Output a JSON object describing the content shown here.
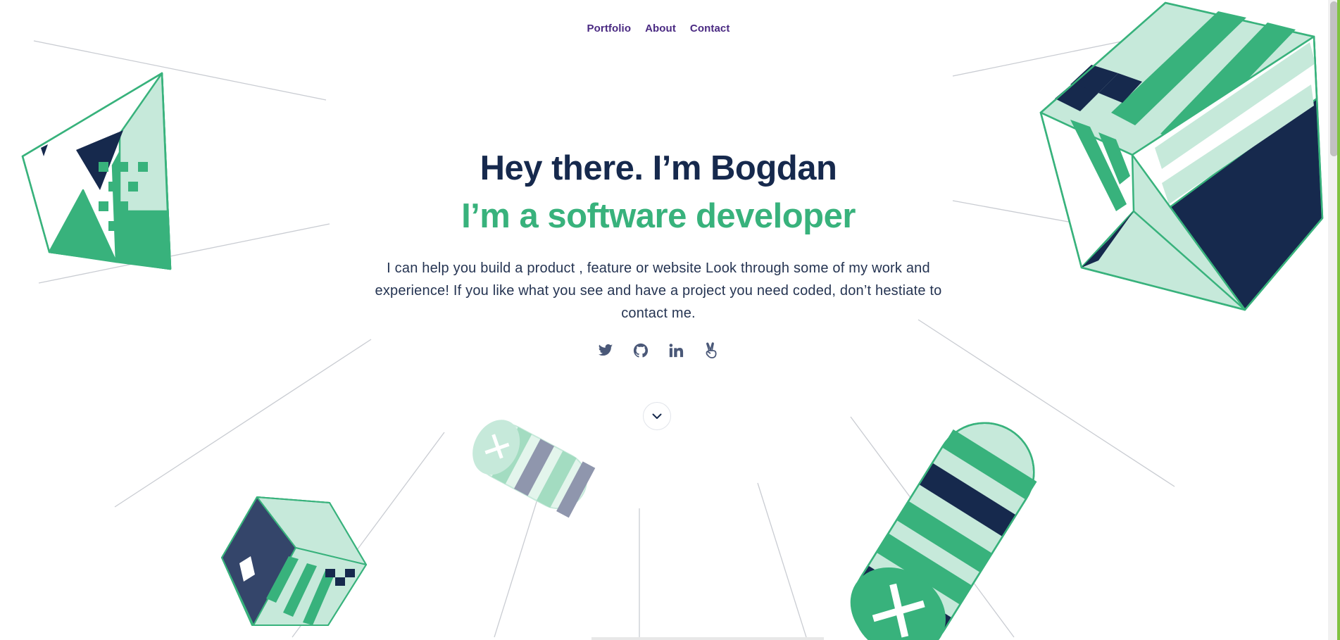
{
  "nav": {
    "items": [
      {
        "label": "Portfolio"
      },
      {
        "label": "About"
      },
      {
        "label": "Contact"
      }
    ]
  },
  "hero": {
    "title": "Hey there. I’m Bogdan",
    "subtitle": "I’m a software developer",
    "description": "I can help you build a product , feature or website Look through some of my work and experience! If you like what you see and have a project you need coded, don’t hestiate to contact me."
  },
  "socials": [
    {
      "icon": "twitter-icon"
    },
    {
      "icon": "github-icon"
    },
    {
      "icon": "linkedin-icon"
    },
    {
      "icon": "angellist-icon"
    }
  ],
  "scroll_down": {
    "icon": "chevron-down-icon"
  },
  "colors": {
    "navy": "#16294d",
    "green": "#38b27c",
    "mint": "#c6e9da",
    "nav_purple": "#4a2a82",
    "text": "#253452",
    "scroll_accent": "#80c242"
  }
}
